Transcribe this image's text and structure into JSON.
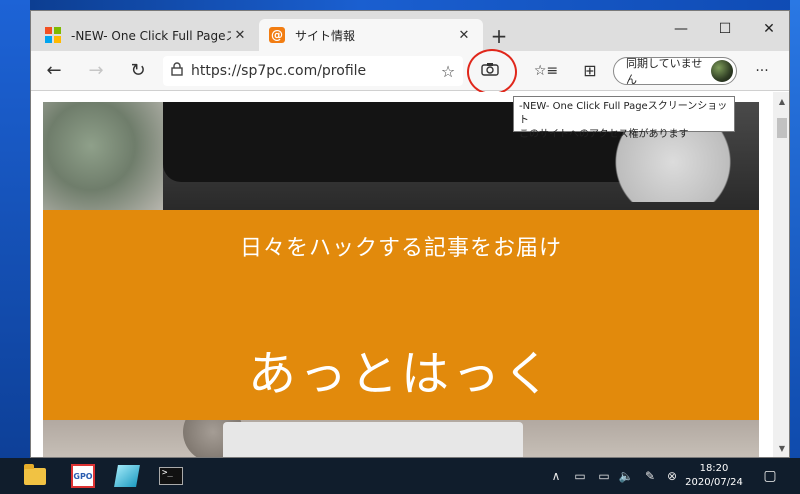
{
  "browser": {
    "tabs": [
      {
        "title": "-NEW- One Click Full Pageスクリーン",
        "favicon": "microsoft-store-icon",
        "active": false
      },
      {
        "title": "サイト情報",
        "favicon": "at-sign-icon",
        "favicon_glyph": "@",
        "active": true
      }
    ],
    "new_tab_glyph": "+",
    "close_glyph": "✕",
    "window_controls": {
      "minimize": "—",
      "maximize": "☐",
      "close": "✕"
    },
    "toolbar": {
      "back_glyph": "←",
      "forward_glyph": "→",
      "refresh_glyph": "↻",
      "url": "https://sp7pc.com/profile",
      "favorite_glyph": "☆",
      "favorites_list_glyph": "☆≡",
      "collections_glyph": "⊞",
      "sync_label": "同期していません",
      "more_glyph": "···"
    },
    "tooltip": {
      "line1": "-NEW- One Click Full Pageスクリーンショット",
      "line2": "このサイトへのアクセス権があります"
    },
    "highlight_color": "#e0271b"
  },
  "page": {
    "tagline": "日々をハックする記事をお届け",
    "site_name": "あっとはっく",
    "banner_color": "#e28a0c"
  },
  "scrollbar": {
    "up_glyph": "▲",
    "down_glyph": "▼"
  },
  "taskbar": {
    "apps": [
      "file-explorer-icon",
      "gpo-app-icon",
      "sticky-app-icon",
      "terminal-icon"
    ],
    "app2_label": "GPO",
    "app4_label": ">_",
    "tray": {
      "chevron": "∧",
      "network": "▭",
      "speaker": "🔈",
      "pen": "✎",
      "close": "⊗"
    },
    "time": "18:20",
    "date": "2020/07/24",
    "notification_glyph": "▢"
  }
}
